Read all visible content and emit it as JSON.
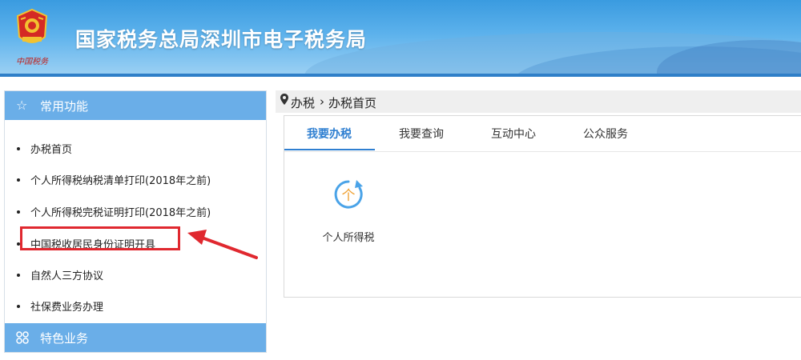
{
  "header": {
    "title": "国家税务总局深圳市电子税务局",
    "emblem_motto": "中国税务",
    "emblem_icon": "tax-emblem-icon"
  },
  "sidebar": {
    "common_title": "常用功能",
    "common_icon": "star-outline-icon",
    "items": [
      {
        "label": "办税首页"
      },
      {
        "label": "个人所得税纳税清单打印(2018年之前)"
      },
      {
        "label": "个人所得税完税证明打印(2018年之前)"
      },
      {
        "label": "中国税收居民身份证明开具"
      },
      {
        "label": "自然人三方协议"
      },
      {
        "label": "社保费业务办理"
      }
    ],
    "special_title": "特色业务",
    "special_icon": "grid-circles-icon"
  },
  "breadcrumb": {
    "icon": "location-pin-icon",
    "level1": "办税",
    "separator": "›",
    "level2": "办税首页"
  },
  "tabs": [
    {
      "label": "我要办税",
      "active": true
    },
    {
      "label": "我要查询",
      "active": false
    },
    {
      "label": "互动中心",
      "active": false
    },
    {
      "label": "公众服务",
      "active": false
    }
  ],
  "services": [
    {
      "label": "个人所得税",
      "icon_char": "个",
      "icon": "personal-tax-icon"
    }
  ],
  "colors": {
    "accent": "#2f7fd1",
    "sidebar_header": "#6aaee8",
    "highlight_red": "#e0282f",
    "icon_orange": "#f0a030",
    "icon_blue": "#4aa3e8"
  }
}
